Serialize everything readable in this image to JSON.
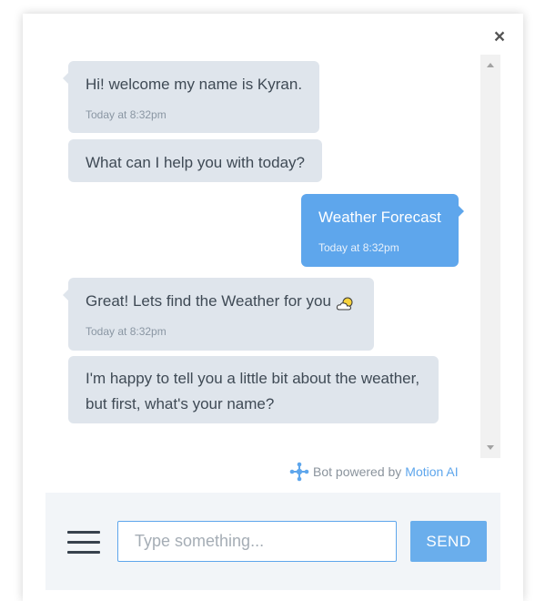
{
  "header": {
    "close_label": "×"
  },
  "messages": [
    {
      "sender": "bot",
      "text": "Hi! welcome my name is Kyran.",
      "time": "Today at 8:32pm"
    },
    {
      "sender": "bot",
      "text": "What can I help you with today?",
      "time": ""
    },
    {
      "sender": "user",
      "text": "Weather Forecast",
      "time": "Today at 8:32pm"
    },
    {
      "sender": "bot",
      "text": "Great! Lets find the Weather for you",
      "time": "Today at 8:32pm",
      "icon": "cloud-sun-icon"
    },
    {
      "sender": "bot",
      "text": "I'm happy to tell you a little bit about the weather, but first, what's your name?",
      "time": ""
    }
  ],
  "footer": {
    "powered_text": "Bot powered by",
    "powered_brand": "Motion AI",
    "input_placeholder": "Type something...",
    "input_value": "",
    "send_label": "SEND",
    "menu_icon": "hamburger-menu-icon"
  },
  "colors": {
    "bot_bubble": "#dfe5ec",
    "user_bubble": "#5ea6ec",
    "accent": "#5ea6ec",
    "send_button": "#6aaeec",
    "footer_bg": "#f2f5f8"
  }
}
